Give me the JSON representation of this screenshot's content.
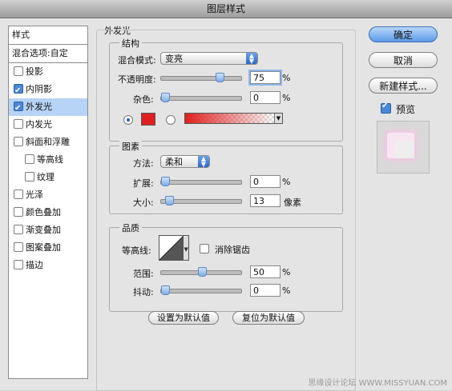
{
  "window": {
    "title": "图层样式"
  },
  "sidebar": {
    "header": "样式",
    "blend_options": "混合选项:自定",
    "items": [
      {
        "label": "投影",
        "checked": false,
        "sub": false,
        "selected": false
      },
      {
        "label": "内阴影",
        "checked": true,
        "sub": false,
        "selected": false
      },
      {
        "label": "外发光",
        "checked": true,
        "sub": false,
        "selected": true
      },
      {
        "label": "内发光",
        "checked": false,
        "sub": false,
        "selected": false
      },
      {
        "label": "斜面和浮雕",
        "checked": false,
        "sub": false,
        "selected": false
      },
      {
        "label": "等高线",
        "checked": false,
        "sub": true,
        "selected": false
      },
      {
        "label": "纹理",
        "checked": false,
        "sub": true,
        "selected": false
      },
      {
        "label": "光泽",
        "checked": false,
        "sub": false,
        "selected": false
      },
      {
        "label": "颜色叠加",
        "checked": false,
        "sub": false,
        "selected": false
      },
      {
        "label": "渐变叠加",
        "checked": false,
        "sub": false,
        "selected": false
      },
      {
        "label": "图案叠加",
        "checked": false,
        "sub": false,
        "selected": false
      },
      {
        "label": "描边",
        "checked": false,
        "sub": false,
        "selected": false
      }
    ]
  },
  "panel": {
    "title": "外发光",
    "structure": {
      "title": "结构",
      "blend_mode_label": "混合模式:",
      "blend_mode_value": "变亮",
      "opacity_label": "不透明度:",
      "opacity_value": "75",
      "opacity_unit": "%",
      "opacity_level": 0.75,
      "noise_label": "杂色:",
      "noise_value": "0",
      "noise_unit": "%",
      "noise_level": 0,
      "solid_color": "#e02020",
      "gradient_color": "#e02020"
    },
    "elements": {
      "title": "图素",
      "technique_label": "方法:",
      "technique_value": "柔和",
      "spread_label": "扩展:",
      "spread_value": "0",
      "spread_unit": "%",
      "spread_level": 0,
      "size_label": "大小:",
      "size_value": "13",
      "size_unit": "像素",
      "size_level": 0.05
    },
    "quality": {
      "title": "品质",
      "contour_label": "等高线:",
      "antialias_label": "消除锯齿",
      "range_label": "范围:",
      "range_value": "50",
      "range_unit": "%",
      "range_level": 0.5,
      "jitter_label": "抖动:",
      "jitter_value": "0",
      "jitter_unit": "%",
      "jitter_level": 0
    },
    "buttons": {
      "make_default": "设置为默认值",
      "reset_default": "复位为默认值"
    }
  },
  "actions": {
    "ok": "确定",
    "cancel": "取消",
    "new_style": "新建样式...",
    "preview_label": "预览",
    "preview_checked": true
  },
  "watermark": "思缘设计论坛 WWW.MISSYUAN.COM"
}
